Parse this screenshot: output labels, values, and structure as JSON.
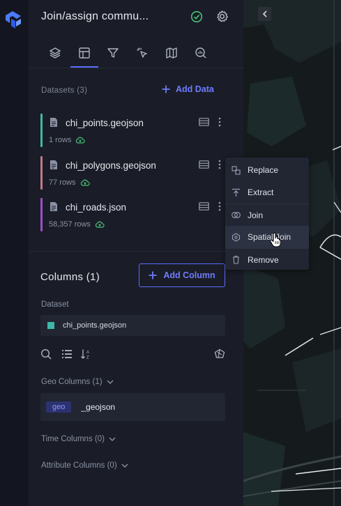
{
  "app": {
    "brand_color": "#5b6cff"
  },
  "header": {
    "title": "Join/assign commu...",
    "status_icon": "check-circle-icon",
    "settings_icon": "gear-icon"
  },
  "tabs": [
    {
      "name": "layers",
      "icon": "layers-icon",
      "active": false
    },
    {
      "name": "table",
      "icon": "table-icon",
      "active": true
    },
    {
      "name": "filter",
      "icon": "filter-icon",
      "active": false
    },
    {
      "name": "interactions",
      "icon": "cursor-click-icon",
      "active": false
    },
    {
      "name": "basemap",
      "icon": "map-icon",
      "active": false
    },
    {
      "name": "analysis",
      "icon": "search-chart-icon",
      "active": false
    }
  ],
  "datasets": {
    "heading": "Datasets (3)",
    "add_label": "Add Data",
    "items": [
      {
        "name": "chi_points.geojson",
        "rows": "1 rows",
        "color": "#3fb8a7"
      },
      {
        "name": "chi_polygons.geojson",
        "rows": "77 rows",
        "color": "#c4788a"
      },
      {
        "name": "chi_roads.json",
        "rows": "58,357 rows",
        "color": "#9b4fc8"
      }
    ]
  },
  "context_menu": {
    "items": [
      {
        "label": "Replace",
        "icon": "replace-icon"
      },
      {
        "label": "Extract",
        "icon": "extract-icon"
      },
      {
        "label": "Join",
        "icon": "join-icon"
      },
      {
        "label": "Spatial Join",
        "icon": "spatial-join-icon",
        "hover": true
      },
      {
        "label": "Remove",
        "icon": "trash-icon"
      }
    ]
  },
  "columns": {
    "title": "Columns (1)",
    "add_label": "Add Column",
    "dataset_label": "Dataset",
    "selected_dataset": "chi_points.geojson",
    "geo_group": "Geo Columns (1)",
    "geo_badge": "geo",
    "geo_column": "_geojson",
    "time_group": "Time Columns (0)",
    "attr_group": "Attribute Columns (0)"
  }
}
